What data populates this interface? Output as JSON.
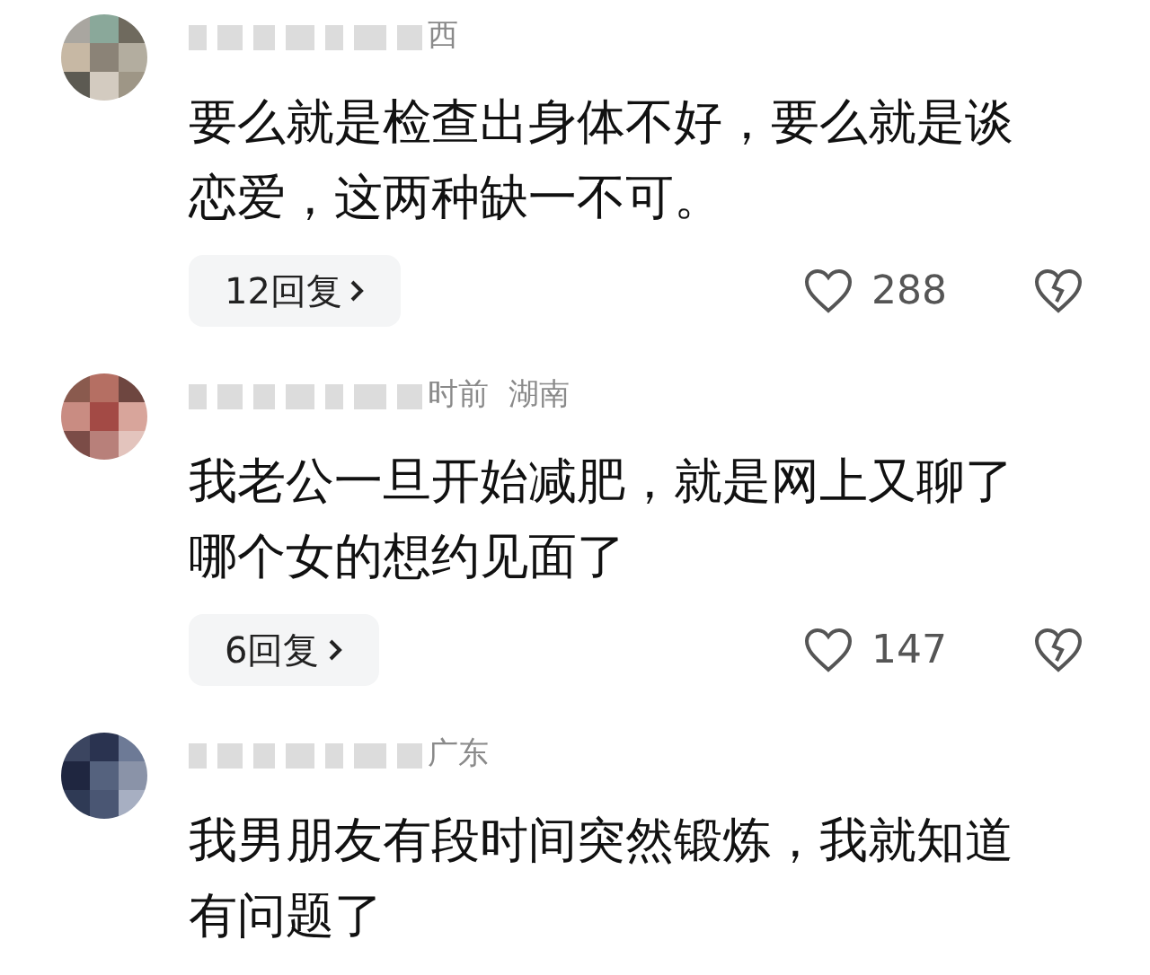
{
  "comments": [
    {
      "meta": "西",
      "text": "要么就是检查出身体不好，要么就是谈恋爱，这两种缺一不可。",
      "replies": "12回复",
      "likes": "288"
    },
    {
      "meta": "时前  湖南",
      "text": "我老公一旦开始减肥，就是网上又聊了哪个女的想约见面了",
      "replies": "6回复",
      "likes": "147"
    },
    {
      "meta": "广东",
      "text": "我男朋友有段时间突然锻炼，我就知道有问题了"
    }
  ]
}
